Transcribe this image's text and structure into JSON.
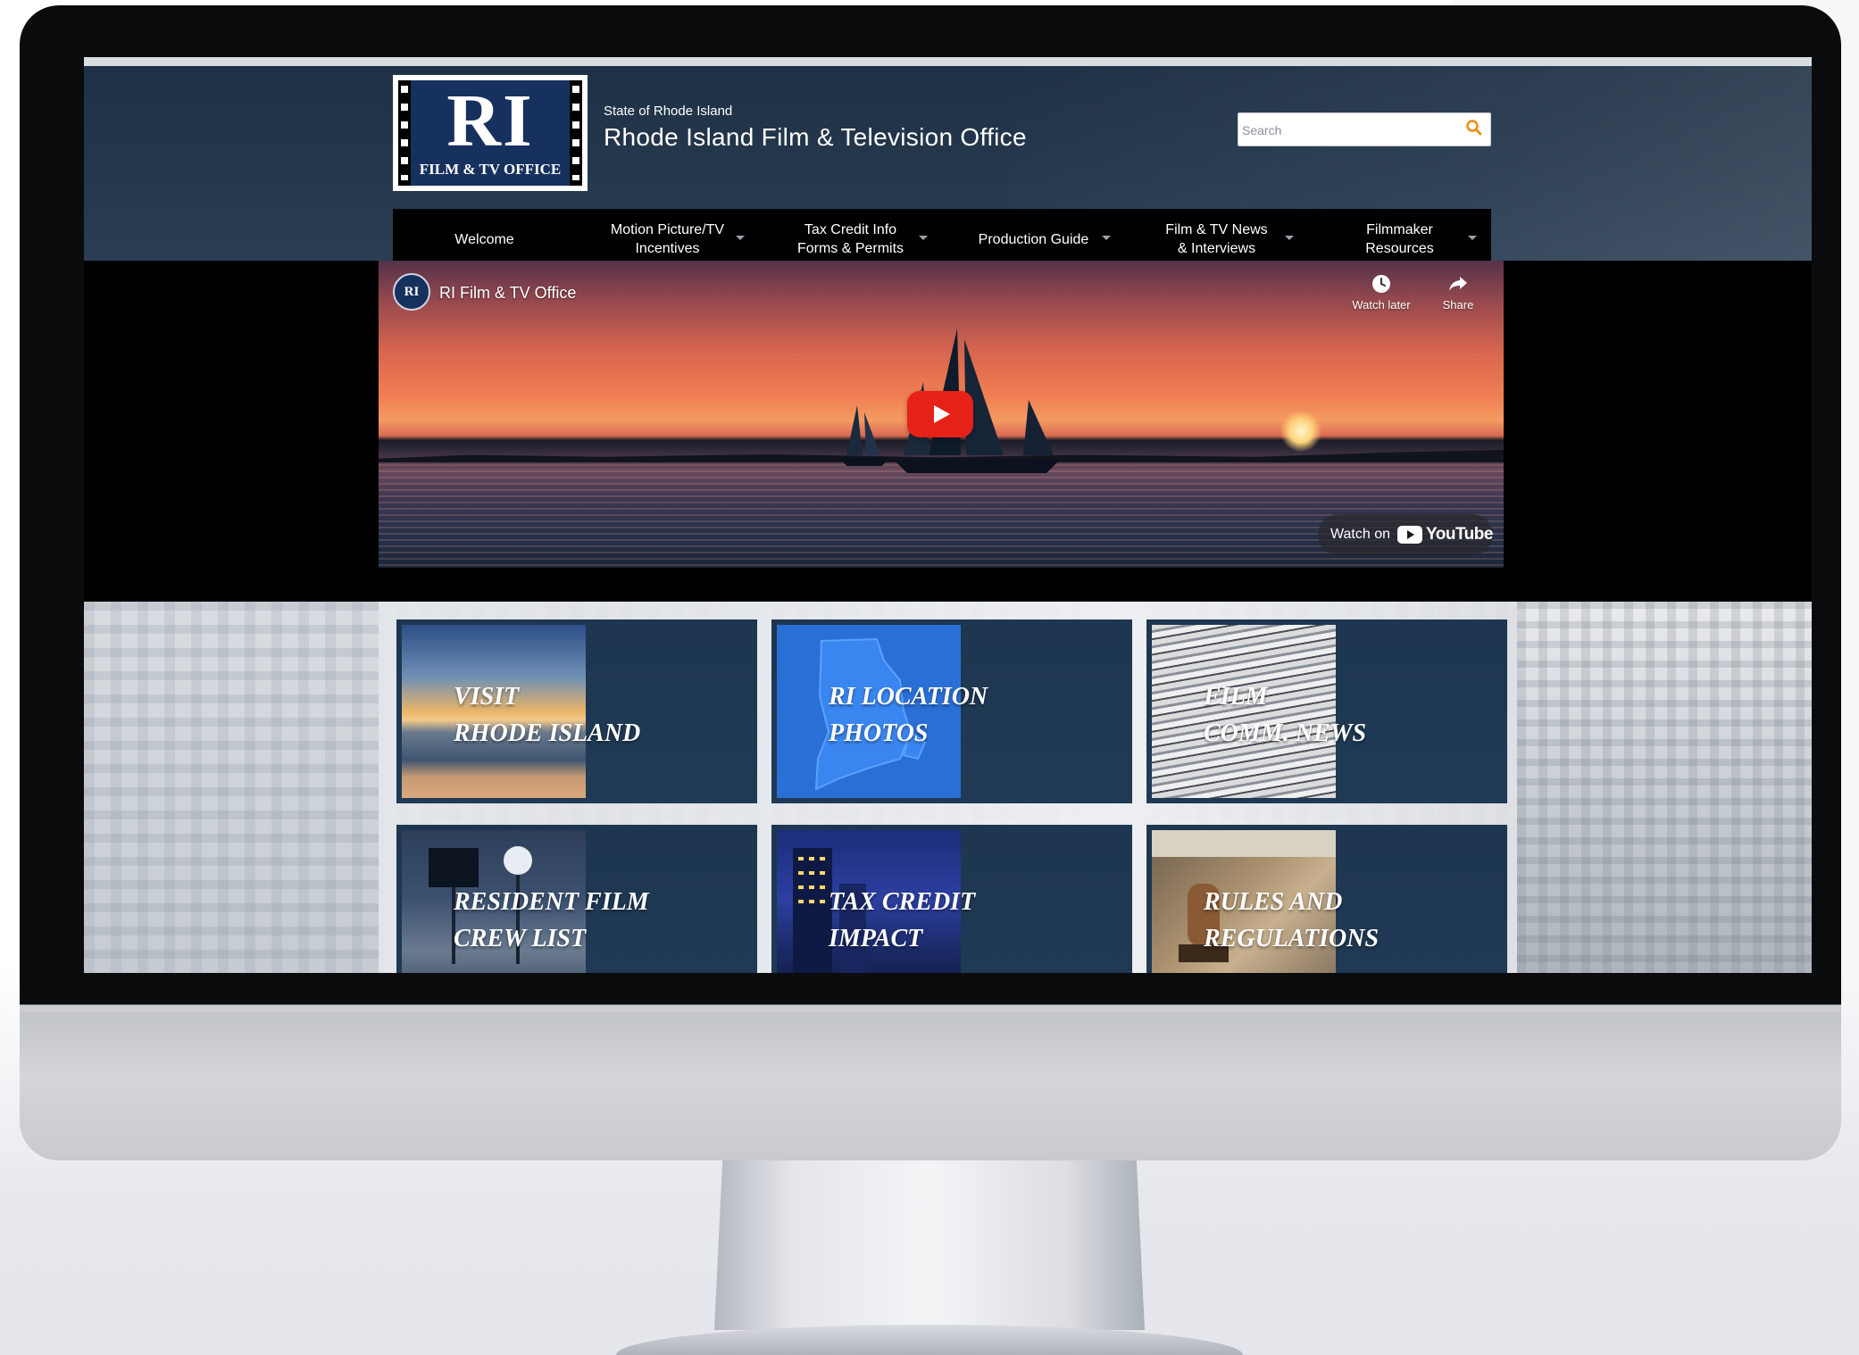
{
  "site": {
    "logo_main": "RI",
    "logo_sub": "FILM & TV OFFICE",
    "state_label": "State of Rhode Island",
    "office_title": "Rhode Island Film & Television Office"
  },
  "search": {
    "placeholder": "Search",
    "icon": "search-icon",
    "icon_color": "#f08c1e"
  },
  "nav": {
    "items": [
      {
        "label": "Welcome",
        "has_dropdown": false
      },
      {
        "label": "Motion Picture/TV\nIncentives",
        "has_dropdown": true
      },
      {
        "label": "Tax Credit Info\nForms & Permits",
        "has_dropdown": true
      },
      {
        "label": "Production Guide",
        "has_dropdown": true
      },
      {
        "label": "Film & TV News\n& Interviews",
        "has_dropdown": true
      },
      {
        "label": "Filmmaker\nResources",
        "has_dropdown": true
      }
    ]
  },
  "video": {
    "channel_avatar": "RI",
    "channel_name": "RI Film & TV Office",
    "watch_later_label": "Watch later",
    "share_label": "Share",
    "watch_on_label": "Watch on",
    "youtube_label": "YouTube",
    "play_color": "#e62117"
  },
  "tiles": [
    {
      "label": "VISIT\nRHODE ISLAND"
    },
    {
      "label": "RI LOCATION\nPHOTOS"
    },
    {
      "label": "FILM\nCOMM. NEWS"
    },
    {
      "label": "RESIDENT FILM\nCREW LIST"
    },
    {
      "label": "TAX CREDIT\nIMPACT"
    },
    {
      "label": "RULES AND\nREGULATIONS"
    }
  ],
  "colors": {
    "header_bg": "#24374c",
    "nav_bg": "#000000",
    "tile_bg": "#1e3650",
    "logo_blue": "#17315e"
  }
}
